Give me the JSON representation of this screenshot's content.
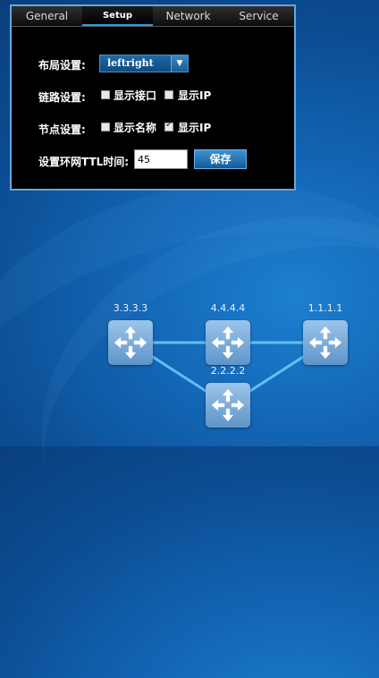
{
  "tabs": [
    {
      "label": "General",
      "active": false
    },
    {
      "label": "Setup",
      "active": true
    },
    {
      "label": "Network",
      "active": false
    },
    {
      "label": "Service",
      "active": false
    }
  ],
  "setup": {
    "layout_label": "布局设置:",
    "layout_value": "leftright",
    "link_label": "链路设置:",
    "link_show_interface": {
      "label": "显示接口",
      "checked": false
    },
    "link_show_ip": {
      "label": "显示IP",
      "checked": false
    },
    "node_label": "节点设置:",
    "node_show_name": {
      "label": "显示名称",
      "checked": false
    },
    "node_show_ip": {
      "label": "显示IP",
      "checked": true
    },
    "ttl_label": "设置环网TTL时间:",
    "ttl_value": "45",
    "save_label": "保存"
  },
  "topology": {
    "nodes": [
      {
        "id": "n3",
        "label": "3.3.3.3"
      },
      {
        "id": "n4",
        "label": "4.4.4.4"
      },
      {
        "id": "n1",
        "label": "1.1.1.1"
      },
      {
        "id": "n2",
        "label": "2.2.2.2"
      }
    ],
    "links": [
      [
        "n3",
        "n4"
      ],
      [
        "n4",
        "n1"
      ],
      [
        "n3",
        "n2"
      ],
      [
        "n2",
        "n1"
      ]
    ],
    "link_color": "#5fc0f5"
  }
}
